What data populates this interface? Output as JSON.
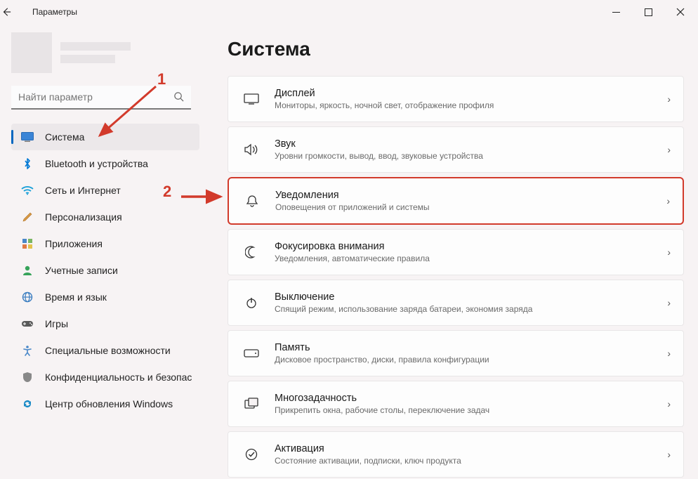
{
  "window": {
    "title": "Параметры"
  },
  "search": {
    "placeholder": "Найти параметр"
  },
  "sidebar": {
    "items": [
      {
        "label": "Система",
        "icon": "system"
      },
      {
        "label": "Bluetooth и устройства",
        "icon": "bluetooth"
      },
      {
        "label": "Сеть и Интернет",
        "icon": "wifi"
      },
      {
        "label": "Персонализация",
        "icon": "brush"
      },
      {
        "label": "Приложения",
        "icon": "apps"
      },
      {
        "label": "Учетные записи",
        "icon": "user"
      },
      {
        "label": "Время и язык",
        "icon": "globe"
      },
      {
        "label": "Игры",
        "icon": "gamepad"
      },
      {
        "label": "Специальные возможности",
        "icon": "accessibility"
      },
      {
        "label": "Конфиденциальность и безопас",
        "icon": "shield"
      },
      {
        "label": "Центр обновления Windows",
        "icon": "update"
      }
    ]
  },
  "page": {
    "title": "Система"
  },
  "settings": [
    {
      "title": "Дисплей",
      "desc": "Мониторы, яркость, ночной свет, отображение профиля",
      "icon": "display"
    },
    {
      "title": "Звук",
      "desc": "Уровни громкости, вывод, ввод, звуковые устройства",
      "icon": "sound"
    },
    {
      "title": "Уведомления",
      "desc": "Оповещения от приложений и системы",
      "icon": "bell",
      "highlight": true
    },
    {
      "title": "Фокусировка внимания",
      "desc": "Уведомления, автоматические правила",
      "icon": "moon"
    },
    {
      "title": "Выключение",
      "desc": "Спящий режим, использование заряда батареи, экономия заряда",
      "icon": "power"
    },
    {
      "title": "Память",
      "desc": "Дисковое пространство, диски, правила конфигурации",
      "icon": "storage"
    },
    {
      "title": "Многозадачность",
      "desc": "Прикрепить окна, рабочие столы, переключение задач",
      "icon": "multitask"
    },
    {
      "title": "Активация",
      "desc": "Состояние активации, подписки, ключ продукта",
      "icon": "activation"
    }
  ],
  "annotations": {
    "num1": "1",
    "num2": "2"
  }
}
